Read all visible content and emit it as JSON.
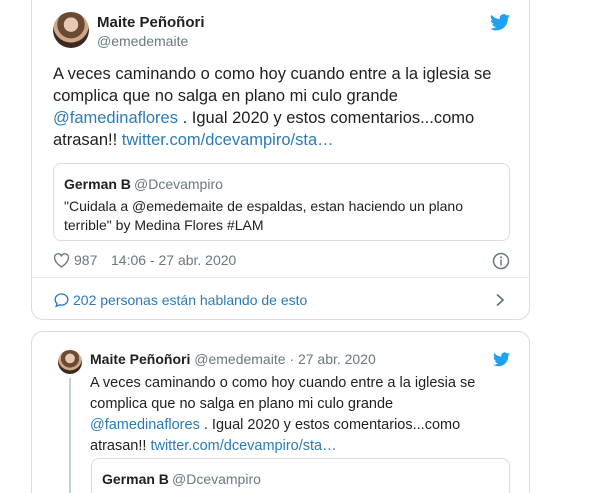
{
  "tweet": {
    "author_name": "Maite Peñoñori",
    "author_handle": "@emedemaite",
    "text_part1": "A veces caminando o como hoy cuando entre a la iglesia se complica que no salga en plano mi culo grande ",
    "mention": "@famedinaflores",
    "text_part2": " . Igual 2020 y estos comentarios...como atrasan!! ",
    "link": "twitter.com/dcevampiro/sta…",
    "quote": {
      "name": "German B",
      "handle": "@Dcevampiro",
      "text": "\"Cuidala a @emedemaite de espaldas, estan haciendo un plano terrible\" by Medina Flores #LAM"
    },
    "likes": "987",
    "timestamp": "14:06 - 27 abr. 2020",
    "conversation": "202 personas están hablando de esto"
  },
  "reply": {
    "author_name": "Maite Peñoñori",
    "author_handle": "@emedemaite · 27 abr. 2020",
    "text_part1": "A veces caminando o como hoy cuando entre a la iglesia se complica que no salga en plano mi culo grande ",
    "mention": "@famedinaflores",
    "text_part2": " . Igual 2020 y estos comentarios...como atrasan!! ",
    "link": "twitter.com/dcevampiro/sta…",
    "quote": {
      "name": "German B",
      "handle": "@Dcevampiro"
    }
  },
  "colors": {
    "link": "#2b7bb9",
    "twitter_blue": "#1da1f2",
    "secondary_text": "#697882"
  }
}
